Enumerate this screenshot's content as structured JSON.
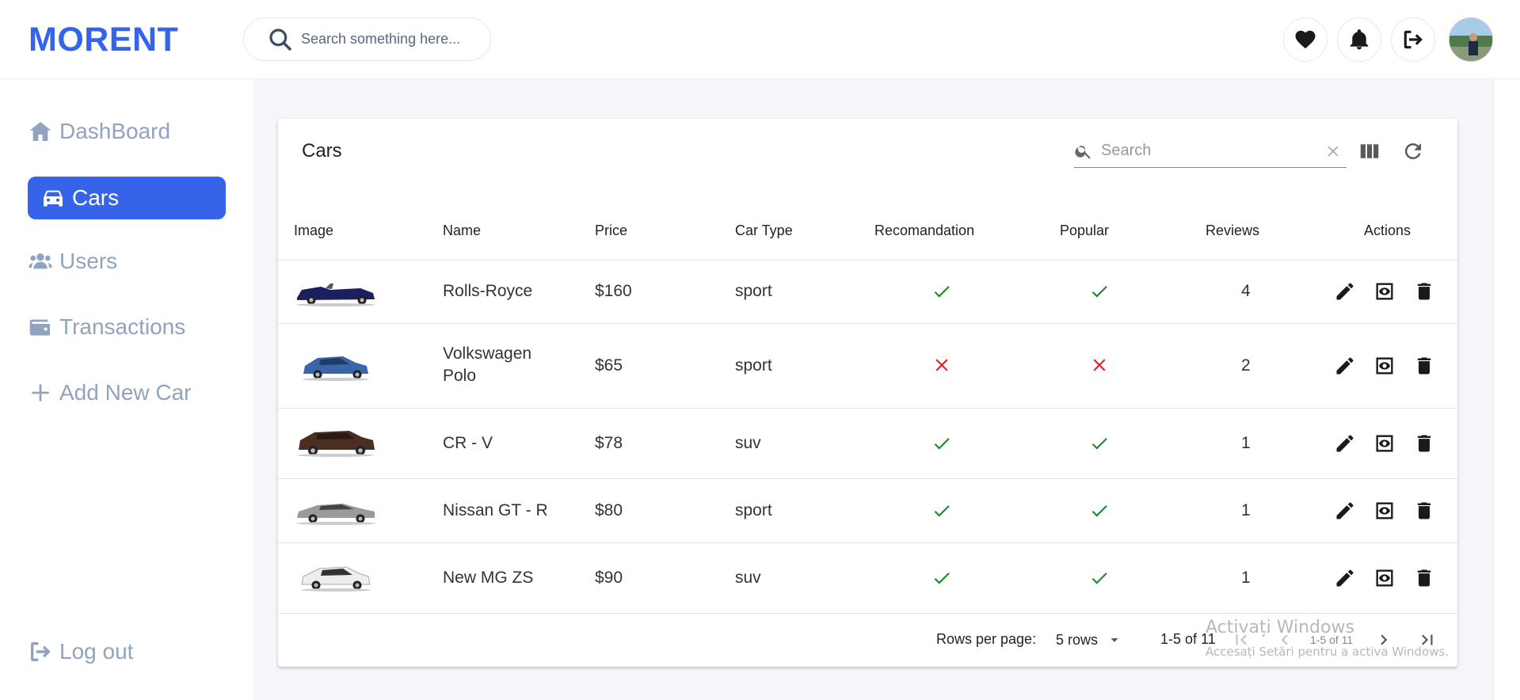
{
  "header": {
    "logo": "MORENT",
    "search_placeholder": "Search something here..."
  },
  "sidebar": {
    "items": [
      {
        "label": "DashBoard",
        "icon": "home-icon"
      },
      {
        "label": "Cars",
        "icon": "car-icon",
        "active": true
      },
      {
        "label": "Users",
        "icon": "users-icon"
      },
      {
        "label": "Transactions",
        "icon": "wallet-icon"
      },
      {
        "label": "Add New Car",
        "icon": "plus-icon"
      }
    ],
    "logout_label": "Log out"
  },
  "table": {
    "title": "Cars",
    "search_placeholder": "Search",
    "columns": [
      "Image",
      "Name",
      "Price",
      "Car Type",
      "Recomandation",
      "Popular",
      "Reviews",
      "Actions"
    ],
    "rows": [
      {
        "name": "Rolls-Royce",
        "price": "$160",
        "type": "sport",
        "recommendation": true,
        "popular": true,
        "reviews": "4",
        "car_color": "#1c1f5e"
      },
      {
        "name_line1": "Volkswagen",
        "name_line2": "Polo",
        "price": "$65",
        "type": "sport",
        "recommendation": false,
        "popular": false,
        "reviews": "2",
        "car_color": "#3a65a8"
      },
      {
        "name": "CR - V",
        "price": "$78",
        "type": "suv",
        "recommendation": true,
        "popular": true,
        "reviews": "1",
        "car_color": "#4a2e22"
      },
      {
        "name": "Nissan GT - R",
        "price": "$80",
        "type": "sport",
        "recommendation": true,
        "popular": true,
        "reviews": "1",
        "car_color": "#9a9a9a"
      },
      {
        "name": "New MG ZS",
        "price": "$90",
        "type": "suv",
        "recommendation": true,
        "popular": true,
        "reviews": "1",
        "car_color": "#eeeeee"
      }
    ],
    "footer": {
      "rows_per_page_label": "Rows per page:",
      "rows_per_page_value": "5 rows",
      "range": "1-5 of 11",
      "range_faded": "1-5 of 11"
    }
  },
  "watermark": {
    "line1": "Activați Windows",
    "line2": "Accesați Setări pentru a activa Windows."
  },
  "colors": {
    "brand": "#3563E9",
    "check": "#1e8c2f",
    "cross": "#e02424",
    "muted": "#90a3bf"
  }
}
